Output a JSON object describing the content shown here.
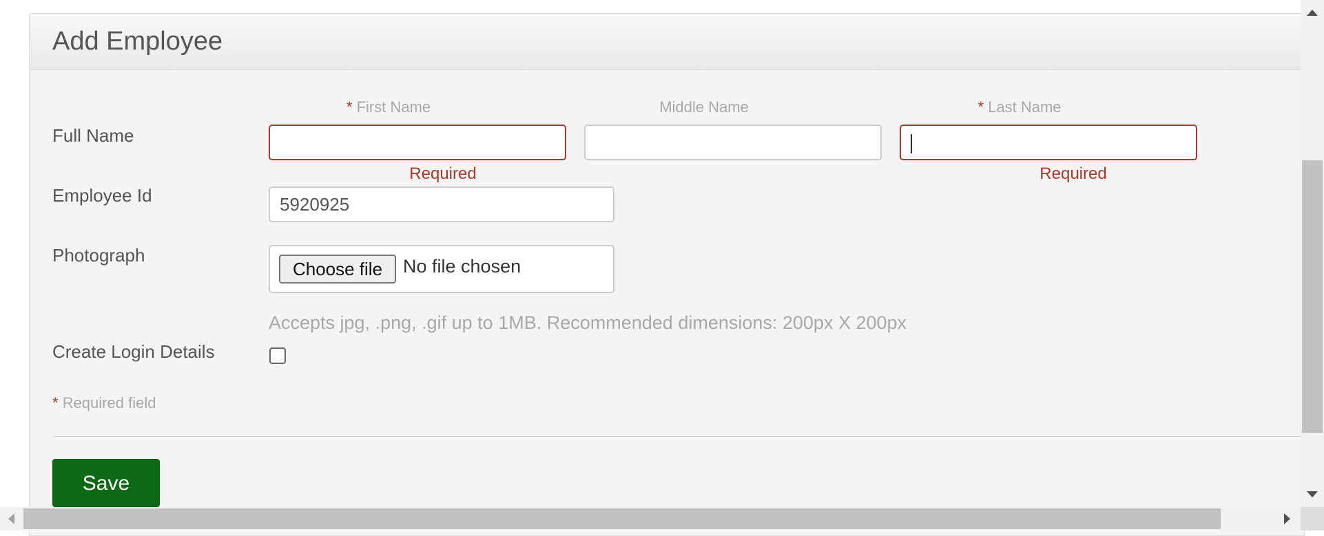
{
  "form": {
    "title": "Add Employee",
    "required_marker": "*",
    "full_name": {
      "label": "Full Name",
      "first_name": {
        "column_label": "First Name",
        "value": "",
        "error": "Required"
      },
      "middle_name": {
        "column_label": "Middle Name",
        "value": ""
      },
      "last_name": {
        "column_label": "Last Name",
        "value": "",
        "error": "Required"
      }
    },
    "employee_id": {
      "label": "Employee Id",
      "value": "5920925"
    },
    "photograph": {
      "label": "Photograph",
      "choose_label": "Choose file",
      "status": "No file chosen",
      "hint": "Accepts jpg, .png, .gif up to 1MB. Recommended dimensions: 200px X 200px"
    },
    "create_login": {
      "label": "Create Login Details",
      "checked": false
    },
    "required_note": "Required field",
    "save_label": "Save"
  },
  "colors": {
    "error": "#a7392c",
    "save_button": "#0c6a14",
    "panel_bg": "#f4f4f4"
  }
}
